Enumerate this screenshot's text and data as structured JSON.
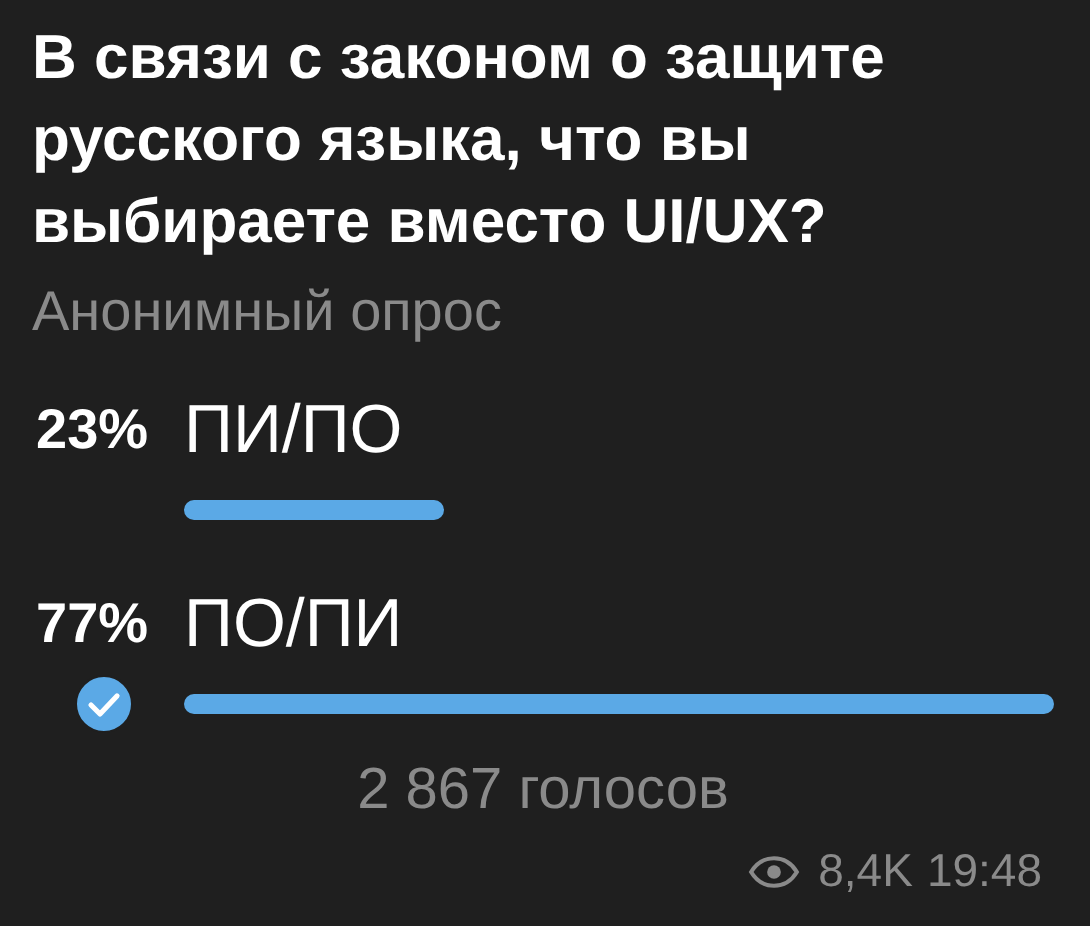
{
  "poll": {
    "question": "В связи с законом о защите русского языка, что вы выбираете вместо UI/UX?",
    "type_label": "Анонимный опрос",
    "options": [
      {
        "percent": "23%",
        "label": "ПИ/ПО",
        "selected": false
      },
      {
        "percent": "77%",
        "label": "ПО/ПИ",
        "selected": true
      }
    ],
    "total_votes": "2 867 голосов",
    "views": "8,4K",
    "time": "19:48"
  }
}
